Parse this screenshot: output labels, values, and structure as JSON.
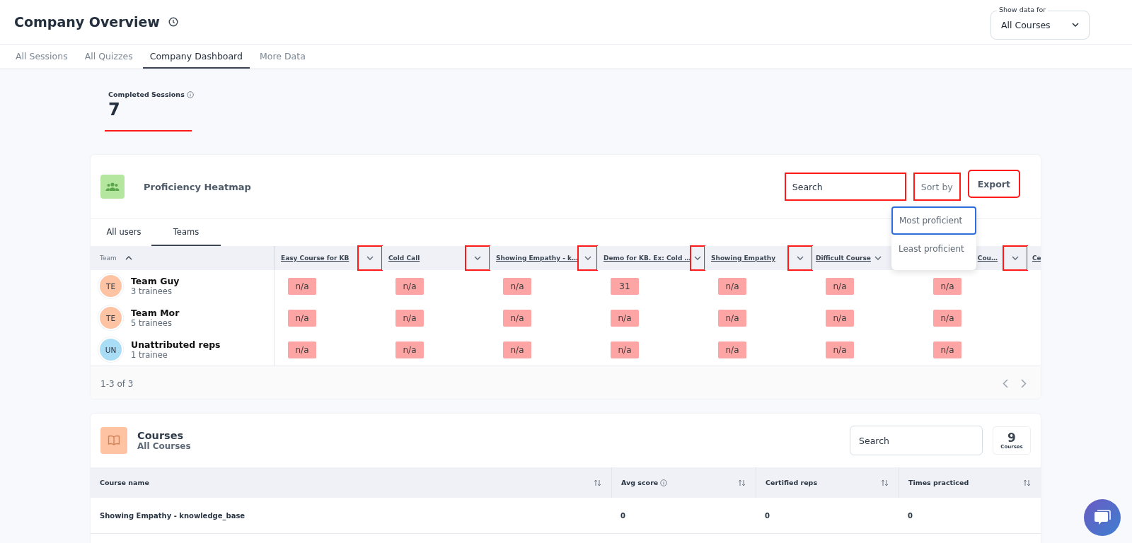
{
  "header": {
    "title": "Company Overview",
    "filter": {
      "label": "Show data for",
      "value": "All Courses"
    }
  },
  "tabs": [
    {
      "label": "All Sessions",
      "selected": false
    },
    {
      "label": "All Quizzes",
      "selected": false
    },
    {
      "label": "Company Dashboard",
      "selected": true
    },
    {
      "label": "More Data",
      "selected": false
    }
  ],
  "stat": {
    "label": "Completed Sessions",
    "value": "7",
    "highlighted": true
  },
  "heatmap": {
    "title": "Proficiency Heatmap",
    "search": {
      "placeholder": "Search",
      "highlighted": true
    },
    "sort_button": {
      "label": "Sort by",
      "highlighted": true
    },
    "export_button": {
      "label": "Export",
      "highlighted": true
    },
    "sort_menu": [
      {
        "label": "Most proficient",
        "selected": true
      },
      {
        "label": "Least proficient",
        "selected": false
      }
    ],
    "tabs": [
      {
        "label": "All users",
        "selected": false
      },
      {
        "label": "Teams",
        "selected": true
      }
    ],
    "team_header": "Team",
    "columns": [
      {
        "label": "Easy Course for KB",
        "highlighted": true
      },
      {
        "label": "Cold Call",
        "highlighted": true
      },
      {
        "label": "Showing Empathy - k…",
        "highlighted": true
      },
      {
        "label": "Demo for KB. Ex: Cold …",
        "highlighted": true
      },
      {
        "label": "Showing Empathy",
        "highlighted": true
      },
      {
        "label": "Difficult Course",
        "highlighted": false
      },
      {
        "label": "Cou…",
        "highlighted": true
      },
      {
        "label": "Ce",
        "kind": "cut"
      }
    ],
    "rows": [
      {
        "initials": "TE",
        "name": "Team Guy",
        "sub": "3 trainees",
        "color": "#fdc3a2",
        "cells": [
          "n/a",
          "n/a",
          "n/a",
          "31",
          "n/a",
          "n/a",
          "n/a"
        ]
      },
      {
        "initials": "TE",
        "name": "Team Mor",
        "sub": "5 trainees",
        "color": "#fdc3a2",
        "cells": [
          "n/a",
          "n/a",
          "n/a",
          "n/a",
          "n/a",
          "n/a",
          "n/a"
        ]
      },
      {
        "initials": "UN",
        "name": "Unattributed reps",
        "sub": "1 trainee",
        "color": "#a9ddf6",
        "cells": [
          "n/a",
          "n/a",
          "n/a",
          "n/a",
          "n/a",
          "n/a",
          "n/a"
        ]
      }
    ],
    "pagination": "1-3 of 3"
  },
  "courses": {
    "title": "Courses",
    "subtitle": "All Courses",
    "search": {
      "placeholder": "Search"
    },
    "count": {
      "value": "9",
      "label": "Courses"
    },
    "columns": [
      {
        "label": "Course name"
      },
      {
        "label": "Avg score",
        "info": true
      },
      {
        "label": "Certified reps"
      },
      {
        "label": "Times practiced"
      }
    ],
    "rows": [
      {
        "cells": [
          "Showing Empathy - knowledge_base",
          "0",
          "0",
          "0"
        ]
      }
    ]
  }
}
